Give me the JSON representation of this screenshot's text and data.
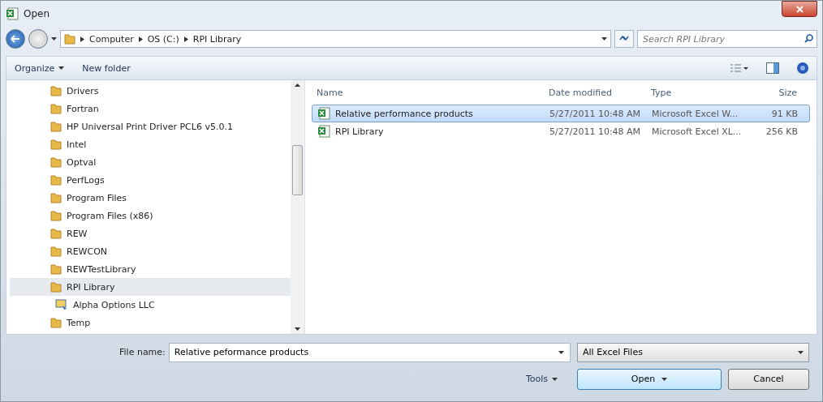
{
  "window": {
    "title": "Open"
  },
  "address": {
    "crumbs": [
      "Computer",
      "OS (C:)",
      "RPI Library"
    ]
  },
  "search": {
    "placeholder": "Search RPI Library"
  },
  "toolbar": {
    "organize": "Organize",
    "new_folder": "New folder"
  },
  "tree": {
    "items": [
      {
        "label": "Drivers",
        "kind": "folder",
        "selected": false
      },
      {
        "label": "Fortran",
        "kind": "folder",
        "selected": false
      },
      {
        "label": "HP Universal Print Driver PCL6 v5.0.1",
        "kind": "folder",
        "selected": false
      },
      {
        "label": "Intel",
        "kind": "folder",
        "selected": false
      },
      {
        "label": "Optval",
        "kind": "folder",
        "selected": false
      },
      {
        "label": "PerfLogs",
        "kind": "folder",
        "selected": false
      },
      {
        "label": "Program Files",
        "kind": "folder",
        "selected": false
      },
      {
        "label": "Program Files (x86)",
        "kind": "folder",
        "selected": false
      },
      {
        "label": "REW",
        "kind": "folder",
        "selected": false
      },
      {
        "label": "REWCON",
        "kind": "folder",
        "selected": false
      },
      {
        "label": "REWTestLibrary",
        "kind": "folder",
        "selected": false
      },
      {
        "label": "RPI Library",
        "kind": "folder",
        "selected": true
      },
      {
        "label": "Alpha Options LLC",
        "kind": "shortcut",
        "selected": false
      },
      {
        "label": "Temp",
        "kind": "folder",
        "selected": false
      }
    ]
  },
  "table": {
    "columns": [
      "Name",
      "Date modified",
      "Type",
      "Size"
    ],
    "rows": [
      {
        "name": "Relative performance products",
        "date": "5/27/2011 10:48 AM",
        "type": "Microsoft Excel W...",
        "size": "91 KB",
        "selected": true
      },
      {
        "name": "RPI Library",
        "date": "5/27/2011 10:48 AM",
        "type": "Microsoft Excel XL...",
        "size": "256 KB",
        "selected": false
      }
    ]
  },
  "footer": {
    "file_name_label": "File name:",
    "file_name": "Relative peformance products",
    "filter": "All Excel Files",
    "tools": "Tools",
    "open": "Open",
    "cancel": "Cancel"
  }
}
